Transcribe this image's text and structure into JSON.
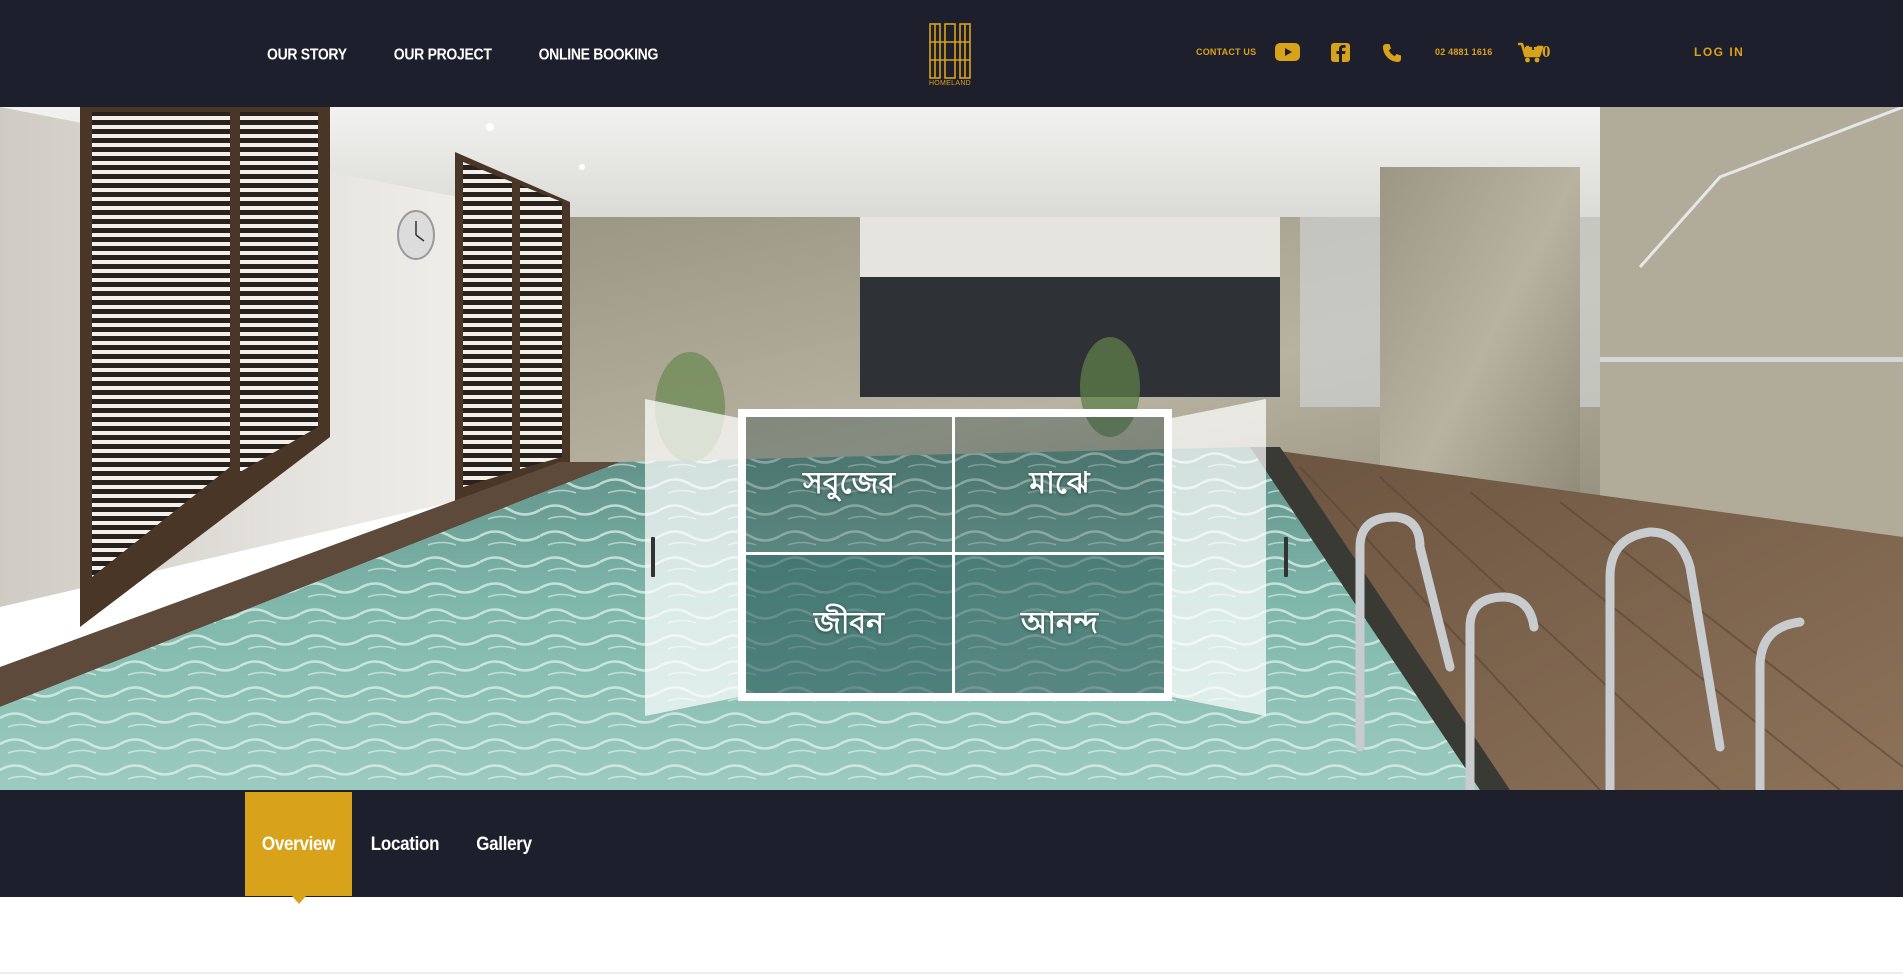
{
  "header": {
    "nav": [
      {
        "label": "OUR STORY"
      },
      {
        "label": "OUR PROJECT"
      },
      {
        "label": "ONLINE BOOKING"
      }
    ],
    "logo_text": "HOMELAND",
    "contact_label": "CONTACT US",
    "phone_number": "02 4881 1616",
    "cart_count": "0",
    "login_label": "LOG IN",
    "icons": [
      "youtube-icon",
      "facebook-icon",
      "phone-icon",
      "cart-icon"
    ],
    "accent_color": "#d9a21b",
    "bg_color": "#1e1f2d"
  },
  "hero": {
    "slogan": [
      "সবুজের",
      "মাঝে",
      "জীবন",
      "আনন্দ"
    ]
  },
  "tabs": [
    {
      "label": "Overview",
      "active": true
    },
    {
      "label": "Location",
      "active": false
    },
    {
      "label": "Gallery",
      "active": false
    }
  ]
}
